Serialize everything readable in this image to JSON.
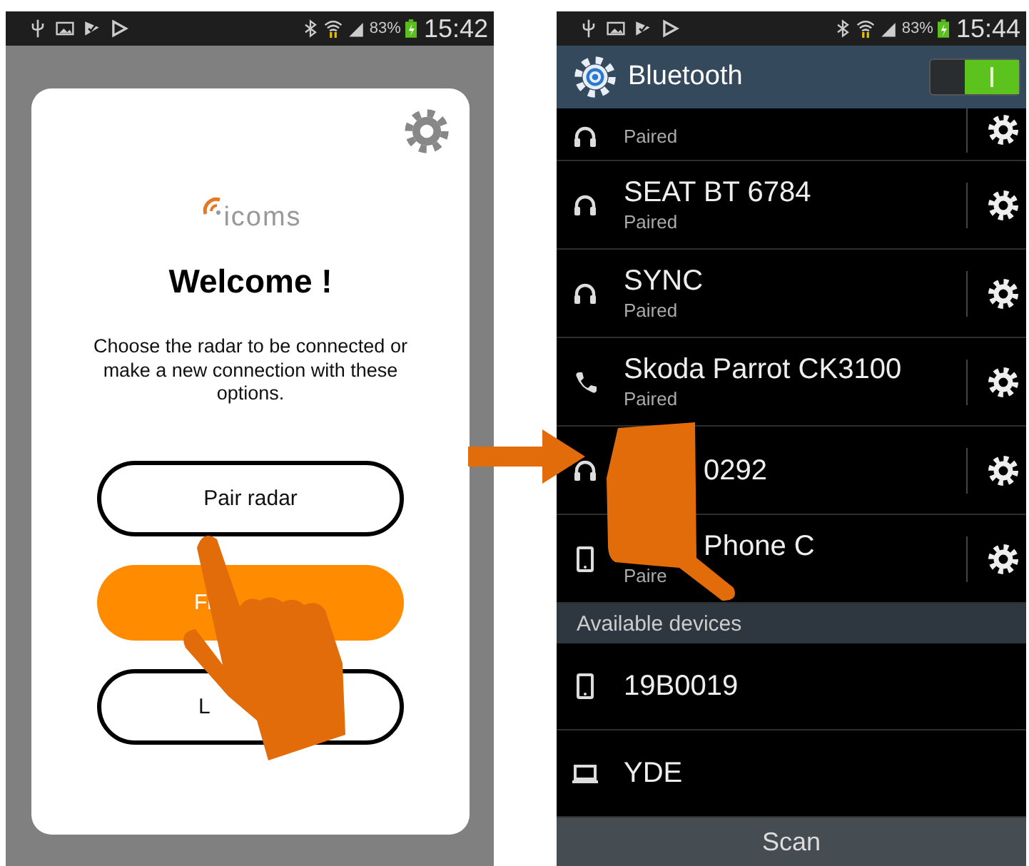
{
  "left_screen": {
    "status_bar": {
      "battery": "83%",
      "time": "15:42"
    },
    "logo": "icoms",
    "title": "Welcome !",
    "description": "Choose the radar to be connected or make a new connection with these options.",
    "buttons": [
      {
        "label": "Pair radar",
        "kind": "outline",
        "covered": false
      },
      {
        "label": "Fi",
        "kind": "filled",
        "covered": true
      },
      {
        "label": "L",
        "kind": "outline",
        "covered": true
      }
    ]
  },
  "right_screen": {
    "status_bar": {
      "battery": "83%",
      "time": "15:44"
    },
    "title": "Bluetooth",
    "toggle": {
      "on": true
    },
    "paired_devices": [
      {
        "subtitle": "Paired",
        "kind": "headphones",
        "partial": true,
        "covered": false
      },
      {
        "name": "SEAT BT 6784",
        "subtitle": "Paired",
        "kind": "headphones",
        "partial": false,
        "covered": false
      },
      {
        "name": "SYNC",
        "subtitle": "Paired",
        "kind": "headphones",
        "partial": false,
        "covered": false
      },
      {
        "name": "Skoda Parrot CK3100",
        "subtitle": "Paired",
        "kind": "phone",
        "partial": false,
        "covered": false
      },
      {
        "name": "0292",
        "kind": "headphones",
        "partial": false,
        "covered": true
      },
      {
        "name": "Phone C",
        "subtitle": "Paire",
        "kind": "smartphone",
        "partial": false,
        "covered": true
      }
    ],
    "section_header": "Available devices",
    "available_devices": [
      {
        "name": "19B0019",
        "kind": "smartphone"
      },
      {
        "name": "YDE",
        "kind": "laptop"
      }
    ],
    "scan_button": "Scan"
  }
}
